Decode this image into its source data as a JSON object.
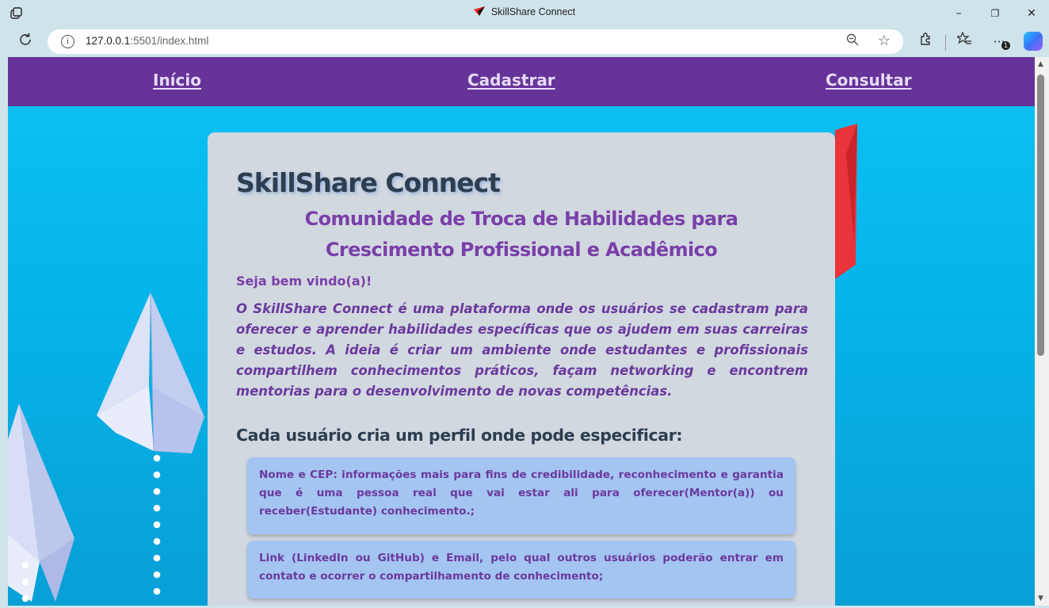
{
  "browser": {
    "tab_title": "SkillShare Connect",
    "url_host": "127.0.0.1",
    "url_rest": ":5501/index.html",
    "notification_count": "1",
    "window_controls": {
      "minimize": "–",
      "maximize": "❐",
      "close": "✕"
    }
  },
  "nav": {
    "home": "Início",
    "register": "Cadastrar",
    "search": "Consultar"
  },
  "main": {
    "title": "SkillShare Connect",
    "subtitle_line1": "Comunidade de Troca de Habilidades para",
    "subtitle_line2": "Crescimento Profissional e Acadêmico",
    "welcome": "Seja bem vindo(a)!",
    "intro": "O SkillShare Connect é uma plataforma onde os usuários se cadastram para oferecer e aprender habilidades específicas que os ajudem em suas carreiras e estudos. A ideia é criar um ambiente onde estudantes e profissionais compartilhem conhecimentos práticos, façam networking e encontrem mentorias para o desenvolvimento de novas competências.",
    "profile_heading": "Cada usuário cria um perfil onde pode especificar:",
    "profile_items": [
      "Nome e CEP: informações mais para fins de credibilidade, reconhecimento e garantia que é uma pessoa real que vai estar ali para oferecer(Mentor(a)) ou receber(Estudante) conhecimento.;",
      "Link (LinkedIn ou GitHub) e Email, pelo qual outros usuários poderão entrar em contato e ocorrer o compartilhamento de conhecimento;"
    ]
  },
  "colors": {
    "nav_bg": "#663399",
    "page_bg": "#06b4ea",
    "card_bg": "#d1d8e0",
    "accent_purple": "#7a3fa8",
    "heading_dark": "#2c3e50",
    "item_bg": "#a4c4f2"
  },
  "icons": [
    "workspaces-icon",
    "favicon-paper-plane-icon",
    "refresh-icon",
    "info-icon",
    "zoom-out-icon",
    "favorite-star-icon",
    "extensions-icon",
    "favorites-icon",
    "more-icon",
    "copilot-icon"
  ]
}
